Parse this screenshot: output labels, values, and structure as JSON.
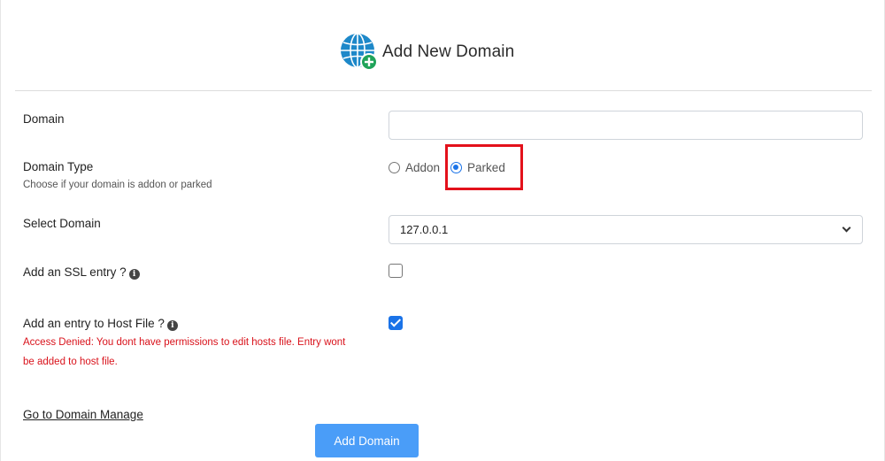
{
  "header": {
    "title": "Add New Domain",
    "icon": "globe-add-icon"
  },
  "form": {
    "domain": {
      "label": "Domain",
      "value": "",
      "placeholder": ""
    },
    "domain_type": {
      "label": "Domain Type",
      "help": "Choose if your domain is addon or parked",
      "options": [
        {
          "label": "Addon",
          "checked": false
        },
        {
          "label": "Parked",
          "checked": true
        }
      ]
    },
    "select_domain": {
      "label": "Select Domain",
      "selected": "127.0.0.1"
    },
    "ssl": {
      "label": "Add an SSL entry ?",
      "checked": false
    },
    "host_file": {
      "label": "Add an entry to Host File ?",
      "checked": true,
      "error": "Access Denied: You dont have permissions to edit hosts file. Entry wont be added to host file."
    }
  },
  "footer": {
    "manage_link": "Go to Domain Manage",
    "submit_label": "Add Domain"
  },
  "colors": {
    "accent": "#1a73e8",
    "button": "#4a9df8",
    "error": "#d9121b",
    "highlight": "#e3111b"
  }
}
